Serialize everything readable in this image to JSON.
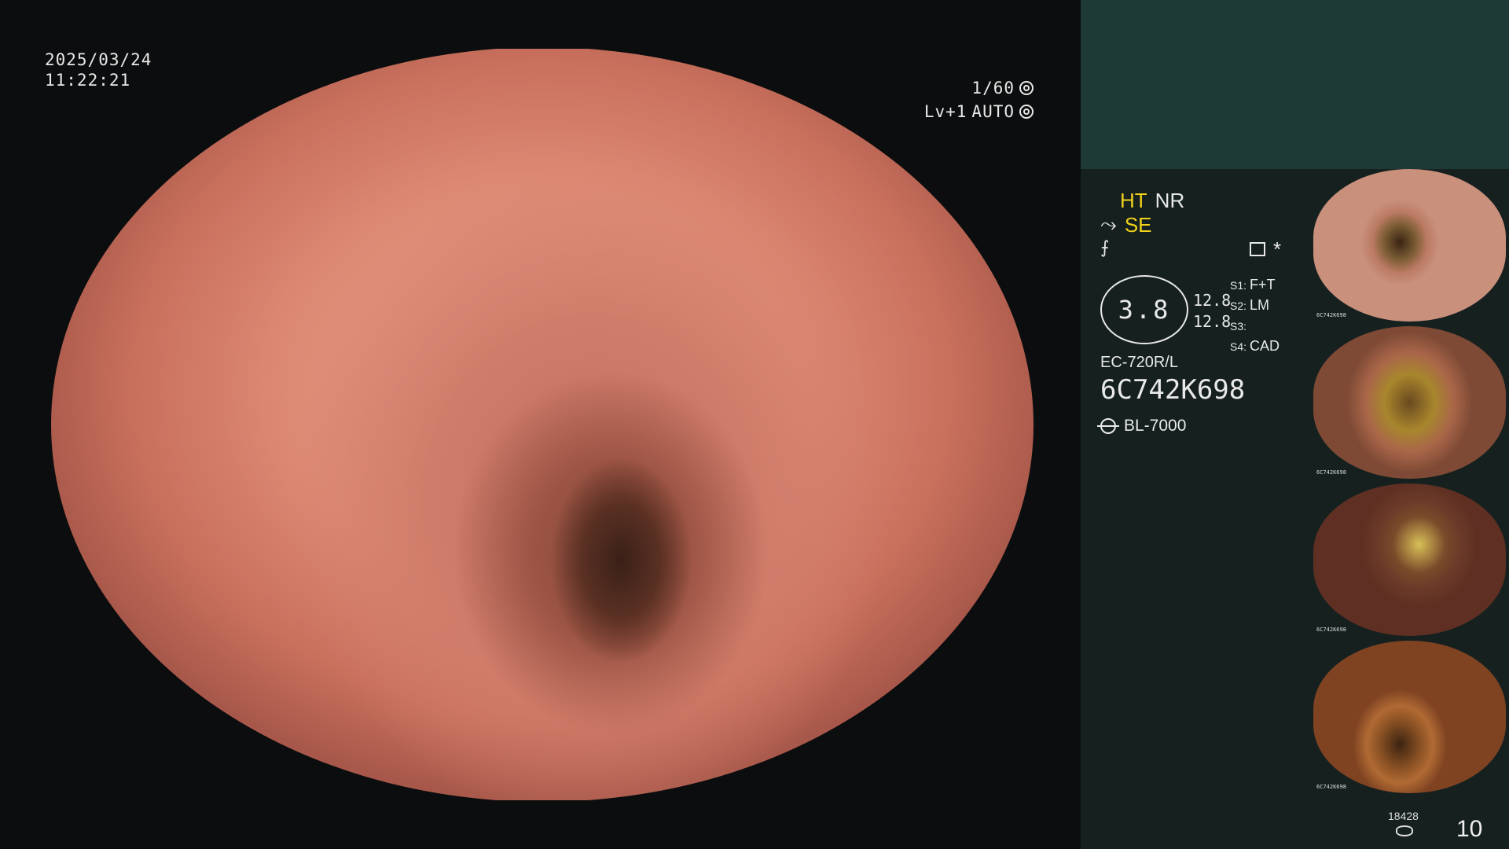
{
  "osd": {
    "date": "2025/03/24",
    "time": "11:22:21",
    "shutter": "1/60",
    "level_label": "Lv+1",
    "exposure_mode": "AUTO"
  },
  "panel": {
    "mode_ht": "HT",
    "mode_nr": "NR",
    "mode_se": "SE",
    "gauge_value": "3.8",
    "gauge_line1": "12.8",
    "gauge_line2": "12.8",
    "slots": [
      {
        "key": "S1:",
        "value": "F+T"
      },
      {
        "key": "S2:",
        "value": "LM"
      },
      {
        "key": "S3:",
        "value": ""
      },
      {
        "key": "S4:",
        "value": "CAD"
      }
    ],
    "scope_model": "EC-720R/L",
    "scope_serial": "6C742K698",
    "light_source": "BL-7000",
    "asterisk": "*"
  },
  "thumbnails": [
    {
      "label": "6C742K698"
    },
    {
      "label": "6C742K698"
    },
    {
      "label": "6C742K698"
    },
    {
      "label": "6C742K698"
    }
  ],
  "footer": {
    "storage_count": "18428",
    "image_count": "10"
  },
  "colors": {
    "accent_yellow": "#f2d21b",
    "panel_top": "#1e3a37",
    "panel_bg": "#15201f"
  }
}
